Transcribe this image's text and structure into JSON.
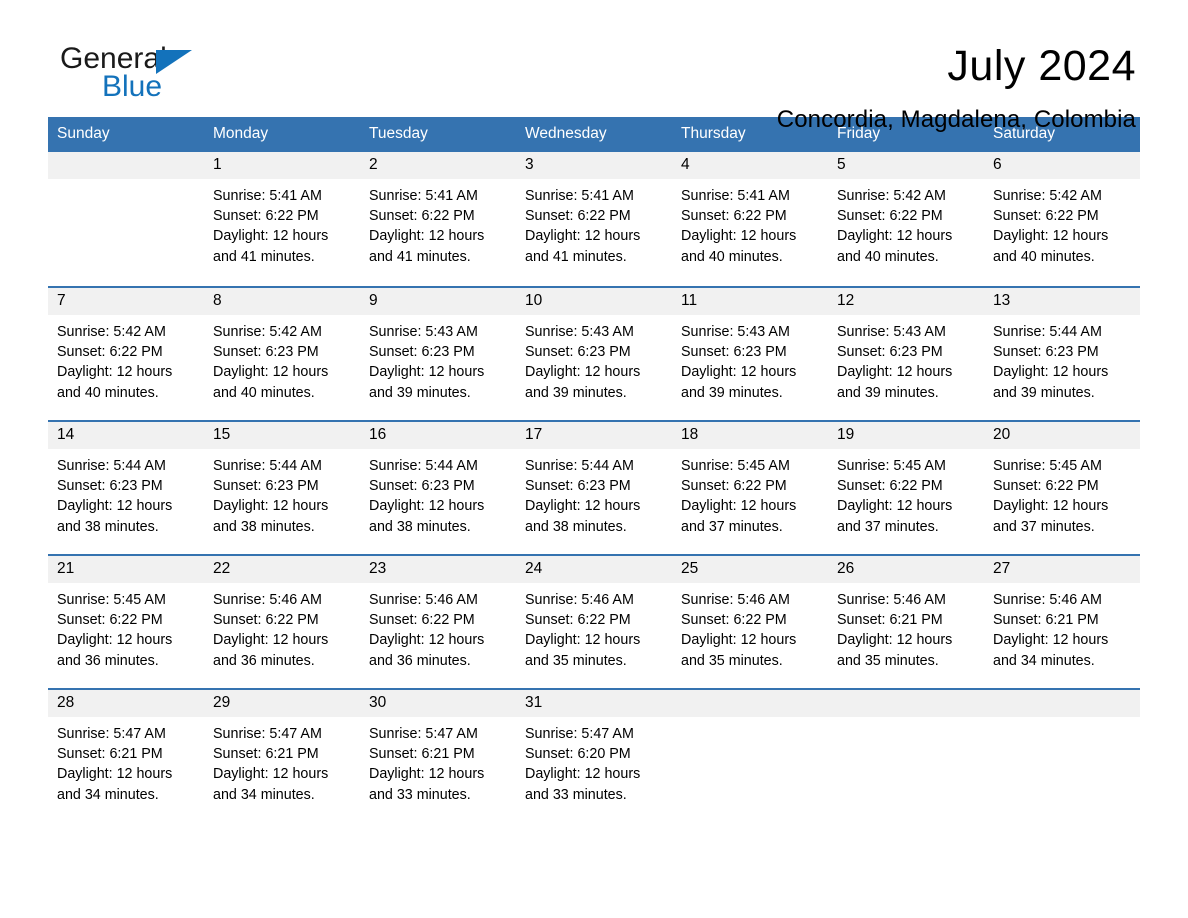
{
  "brand": {
    "name_top": "General",
    "name_bottom": "Blue",
    "accent_color": "#1372bb"
  },
  "header": {
    "title": "July 2024",
    "location": "Concordia, Magdalena, Colombia"
  },
  "calendar": {
    "header_color": "#3573b0",
    "weekdays": [
      "Sunday",
      "Monday",
      "Tuesday",
      "Wednesday",
      "Thursday",
      "Friday",
      "Saturday"
    ],
    "labels": {
      "sunrise": "Sunrise:",
      "sunset": "Sunset:",
      "daylight": "Daylight:"
    },
    "weeks": [
      [
        {
          "day": ""
        },
        {
          "day": "1",
          "sunrise": "Sunrise: 5:41 AM",
          "sunset": "Sunset: 6:22 PM",
          "daylight": "Daylight: 12 hours and 41 minutes."
        },
        {
          "day": "2",
          "sunrise": "Sunrise: 5:41 AM",
          "sunset": "Sunset: 6:22 PM",
          "daylight": "Daylight: 12 hours and 41 minutes."
        },
        {
          "day": "3",
          "sunrise": "Sunrise: 5:41 AM",
          "sunset": "Sunset: 6:22 PM",
          "daylight": "Daylight: 12 hours and 41 minutes."
        },
        {
          "day": "4",
          "sunrise": "Sunrise: 5:41 AM",
          "sunset": "Sunset: 6:22 PM",
          "daylight": "Daylight: 12 hours and 40 minutes."
        },
        {
          "day": "5",
          "sunrise": "Sunrise: 5:42 AM",
          "sunset": "Sunset: 6:22 PM",
          "daylight": "Daylight: 12 hours and 40 minutes."
        },
        {
          "day": "6",
          "sunrise": "Sunrise: 5:42 AM",
          "sunset": "Sunset: 6:22 PM",
          "daylight": "Daylight: 12 hours and 40 minutes."
        }
      ],
      [
        {
          "day": "7",
          "sunrise": "Sunrise: 5:42 AM",
          "sunset": "Sunset: 6:22 PM",
          "daylight": "Daylight: 12 hours and 40 minutes."
        },
        {
          "day": "8",
          "sunrise": "Sunrise: 5:42 AM",
          "sunset": "Sunset: 6:23 PM",
          "daylight": "Daylight: 12 hours and 40 minutes."
        },
        {
          "day": "9",
          "sunrise": "Sunrise: 5:43 AM",
          "sunset": "Sunset: 6:23 PM",
          "daylight": "Daylight: 12 hours and 39 minutes."
        },
        {
          "day": "10",
          "sunrise": "Sunrise: 5:43 AM",
          "sunset": "Sunset: 6:23 PM",
          "daylight": "Daylight: 12 hours and 39 minutes."
        },
        {
          "day": "11",
          "sunrise": "Sunrise: 5:43 AM",
          "sunset": "Sunset: 6:23 PM",
          "daylight": "Daylight: 12 hours and 39 minutes."
        },
        {
          "day": "12",
          "sunrise": "Sunrise: 5:43 AM",
          "sunset": "Sunset: 6:23 PM",
          "daylight": "Daylight: 12 hours and 39 minutes."
        },
        {
          "day": "13",
          "sunrise": "Sunrise: 5:44 AM",
          "sunset": "Sunset: 6:23 PM",
          "daylight": "Daylight: 12 hours and 39 minutes."
        }
      ],
      [
        {
          "day": "14",
          "sunrise": "Sunrise: 5:44 AM",
          "sunset": "Sunset: 6:23 PM",
          "daylight": "Daylight: 12 hours and 38 minutes."
        },
        {
          "day": "15",
          "sunrise": "Sunrise: 5:44 AM",
          "sunset": "Sunset: 6:23 PM",
          "daylight": "Daylight: 12 hours and 38 minutes."
        },
        {
          "day": "16",
          "sunrise": "Sunrise: 5:44 AM",
          "sunset": "Sunset: 6:23 PM",
          "daylight": "Daylight: 12 hours and 38 minutes."
        },
        {
          "day": "17",
          "sunrise": "Sunrise: 5:44 AM",
          "sunset": "Sunset: 6:23 PM",
          "daylight": "Daylight: 12 hours and 38 minutes."
        },
        {
          "day": "18",
          "sunrise": "Sunrise: 5:45 AM",
          "sunset": "Sunset: 6:22 PM",
          "daylight": "Daylight: 12 hours and 37 minutes."
        },
        {
          "day": "19",
          "sunrise": "Sunrise: 5:45 AM",
          "sunset": "Sunset: 6:22 PM",
          "daylight": "Daylight: 12 hours and 37 minutes."
        },
        {
          "day": "20",
          "sunrise": "Sunrise: 5:45 AM",
          "sunset": "Sunset: 6:22 PM",
          "daylight": "Daylight: 12 hours and 37 minutes."
        }
      ],
      [
        {
          "day": "21",
          "sunrise": "Sunrise: 5:45 AM",
          "sunset": "Sunset: 6:22 PM",
          "daylight": "Daylight: 12 hours and 36 minutes."
        },
        {
          "day": "22",
          "sunrise": "Sunrise: 5:46 AM",
          "sunset": "Sunset: 6:22 PM",
          "daylight": "Daylight: 12 hours and 36 minutes."
        },
        {
          "day": "23",
          "sunrise": "Sunrise: 5:46 AM",
          "sunset": "Sunset: 6:22 PM",
          "daylight": "Daylight: 12 hours and 36 minutes."
        },
        {
          "day": "24",
          "sunrise": "Sunrise: 5:46 AM",
          "sunset": "Sunset: 6:22 PM",
          "daylight": "Daylight: 12 hours and 35 minutes."
        },
        {
          "day": "25",
          "sunrise": "Sunrise: 5:46 AM",
          "sunset": "Sunset: 6:22 PM",
          "daylight": "Daylight: 12 hours and 35 minutes."
        },
        {
          "day": "26",
          "sunrise": "Sunrise: 5:46 AM",
          "sunset": "Sunset: 6:21 PM",
          "daylight": "Daylight: 12 hours and 35 minutes."
        },
        {
          "day": "27",
          "sunrise": "Sunrise: 5:46 AM",
          "sunset": "Sunset: 6:21 PM",
          "daylight": "Daylight: 12 hours and 34 minutes."
        }
      ],
      [
        {
          "day": "28",
          "sunrise": "Sunrise: 5:47 AM",
          "sunset": "Sunset: 6:21 PM",
          "daylight": "Daylight: 12 hours and 34 minutes."
        },
        {
          "day": "29",
          "sunrise": "Sunrise: 5:47 AM",
          "sunset": "Sunset: 6:21 PM",
          "daylight": "Daylight: 12 hours and 34 minutes."
        },
        {
          "day": "30",
          "sunrise": "Sunrise: 5:47 AM",
          "sunset": "Sunset: 6:21 PM",
          "daylight": "Daylight: 12 hours and 33 minutes."
        },
        {
          "day": "31",
          "sunrise": "Sunrise: 5:47 AM",
          "sunset": "Sunset: 6:20 PM",
          "daylight": "Daylight: 12 hours and 33 minutes."
        },
        {
          "day": ""
        },
        {
          "day": ""
        },
        {
          "day": ""
        }
      ]
    ]
  }
}
